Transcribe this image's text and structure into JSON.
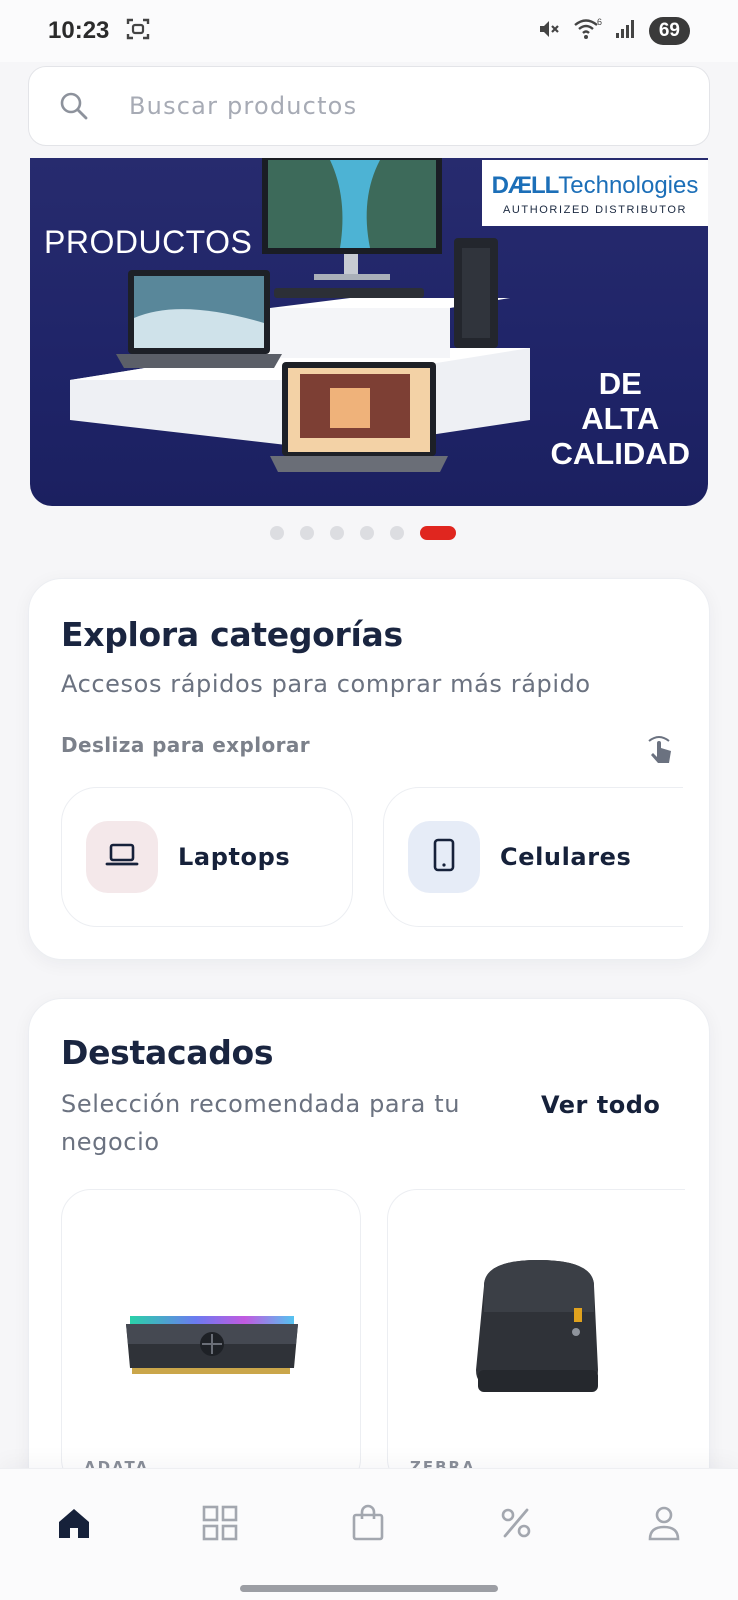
{
  "status_bar": {
    "time": "10:23",
    "battery": "69",
    "signal_label": "6"
  },
  "search": {
    "placeholder": "Buscar productos"
  },
  "banner": {
    "left_text": "PRODUCTOS",
    "right_text_line1": "DE",
    "right_text_line2": "ALTA",
    "right_text_line3": "CALIDAD",
    "badge_brand_bold": "DÆLL",
    "badge_brand_light": "Technologies",
    "badge_sub": "AUTHORIZED DISTRIBUTOR",
    "colors": {
      "background": "#1f2468",
      "accent": "#e0261f"
    }
  },
  "carousel": {
    "total_slides": 6,
    "active_index": 5
  },
  "categories": {
    "title": "Explora categorías",
    "subtitle": "Accesos rápidos para comprar más rápido",
    "swipe_hint": "Desliza para explorar",
    "items": [
      {
        "label": "Laptops",
        "icon": "laptop-icon"
      },
      {
        "label": "Celulares",
        "icon": "phone-icon"
      }
    ]
  },
  "featured": {
    "title": "Destacados",
    "subtitle": "Selección recomendada para tu negocio",
    "see_all": "Ver todo",
    "products": [
      {
        "brand": "ADATA",
        "image": "ram-module-image"
      },
      {
        "brand": "ZEBRA",
        "image": "label-printer-image"
      }
    ]
  },
  "bottom_nav": {
    "items": [
      {
        "icon": "home-icon",
        "active": true
      },
      {
        "icon": "grid-icon",
        "active": false
      },
      {
        "icon": "bag-icon",
        "active": false
      },
      {
        "icon": "percent-icon",
        "active": false
      },
      {
        "icon": "user-icon",
        "active": false
      }
    ]
  }
}
